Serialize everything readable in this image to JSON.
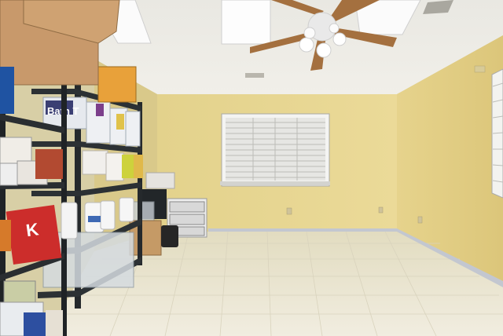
{
  "scene": {
    "description_colors": {
      "ceiling": "#eeece6",
      "wall_left": "#d8c98c",
      "wall_back": "#e6d693",
      "wall_right": "#e2cf86",
      "floor": "#ece8d4",
      "trim": "#c9ccd4",
      "shelf_metal": "#262a2d"
    }
  },
  "labels": {
    "box_top_print": "",
    "cereal_brand": "K",
    "cereal_sub": "",
    "paper_brand": "Bath T"
  }
}
